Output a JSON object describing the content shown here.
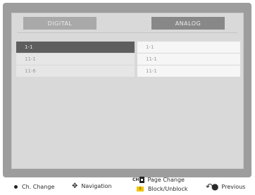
{
  "tabs": [
    {
      "label": "DIGITAL"
    },
    {
      "label": "ANALOG"
    }
  ],
  "channels": [
    {
      "left": "1-1",
      "right": "1-1",
      "selected": true
    },
    {
      "left": "11-1",
      "right": "11-1",
      "selected": false
    },
    {
      "left": "11-6",
      "right": "11-1",
      "selected": false
    }
  ],
  "footer": {
    "ch_change": "Ch. Change",
    "navigation": "Navigation",
    "ch_badge": "CH",
    "page_change": "Page Change",
    "block_key": "1",
    "block_unblock": "Block/Unblock",
    "previous": "Previous"
  },
  "colors": {
    "selected_row": "#5e5e5e",
    "yellow_key": "#f0c400"
  }
}
